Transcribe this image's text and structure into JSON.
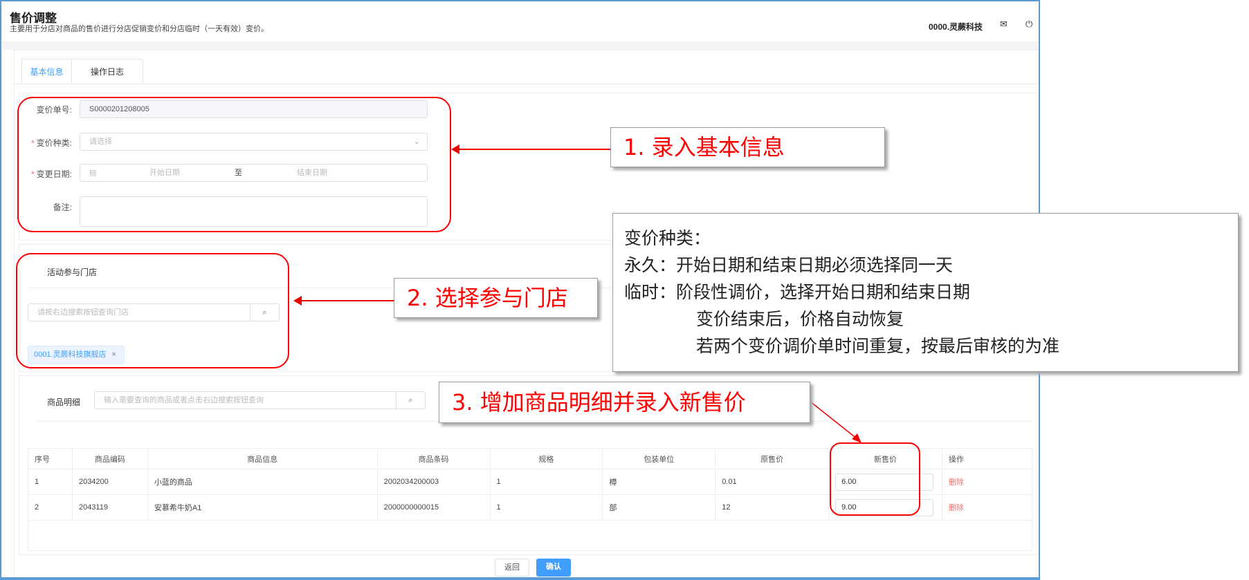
{
  "header": {
    "title": "售价调整",
    "subtitle": "主要用于分店对商品的售价进行分店促销变价和分店临时（一天有效）变价。",
    "user": "0000.灵蕨科技"
  },
  "tabs": [
    {
      "label": "基本信息",
      "active": true
    },
    {
      "label": "操作日志"
    }
  ],
  "form": {
    "order_no_label": "变价单号:",
    "order_no_value": "S0000201208005",
    "type_label": "变价种类:",
    "type_placeholder": "请选择",
    "date_label": "变更日期:",
    "date_start_placeholder": "开始日期",
    "date_sep": "至",
    "date_end_placeholder": "结束日期",
    "remark_label": "备注:"
  },
  "stores": {
    "title": "活动参与门店",
    "search_placeholder": "请按右边搜索按钮查询门店",
    "tags": [
      "0001.灵蕨科技旗舰店"
    ]
  },
  "products": {
    "label": "商品明细",
    "search_placeholder": "输入需要查询的商品或者点击右边搜索按钮查询",
    "columns": [
      "序号",
      "商品编码",
      "商品信息",
      "商品条码",
      "规格",
      "包装单位",
      "原售价",
      "新售价",
      "操作"
    ],
    "rows": [
      {
        "no": "1",
        "code": "2034200",
        "info": "小蓝的商品",
        "barcode": "2002034200003",
        "spec": "1",
        "unit": "樽",
        "old_price": "0.01",
        "new_price": "6.00",
        "action": "删除"
      },
      {
        "no": "2",
        "code": "2043119",
        "info": "安慕希牛奶A1",
        "barcode": "2000000000015",
        "spec": "1",
        "unit": "部",
        "old_price": "12",
        "new_price": "9.00",
        "action": "删除"
      }
    ]
  },
  "footer": {
    "back": "返回",
    "confirm": "确认"
  },
  "annotations": {
    "step1": "1. 录入基本信息",
    "step2": "2. 选择参与门店",
    "step3": "3. 增加商品明细并录入新售价",
    "note_lines": [
      "变价种类：",
      "永久：开始日期和结束日期必须选择同一天",
      "临时：阶段性调价，选择开始日期和结束日期",
      "变价结束后，价格自动恢复",
      "若两个变价调价单时间重复，按最后审核的为准"
    ]
  },
  "colors": {
    "accent": "#409eff",
    "danger": "#f56c6c",
    "annotation": "#ff0000"
  }
}
